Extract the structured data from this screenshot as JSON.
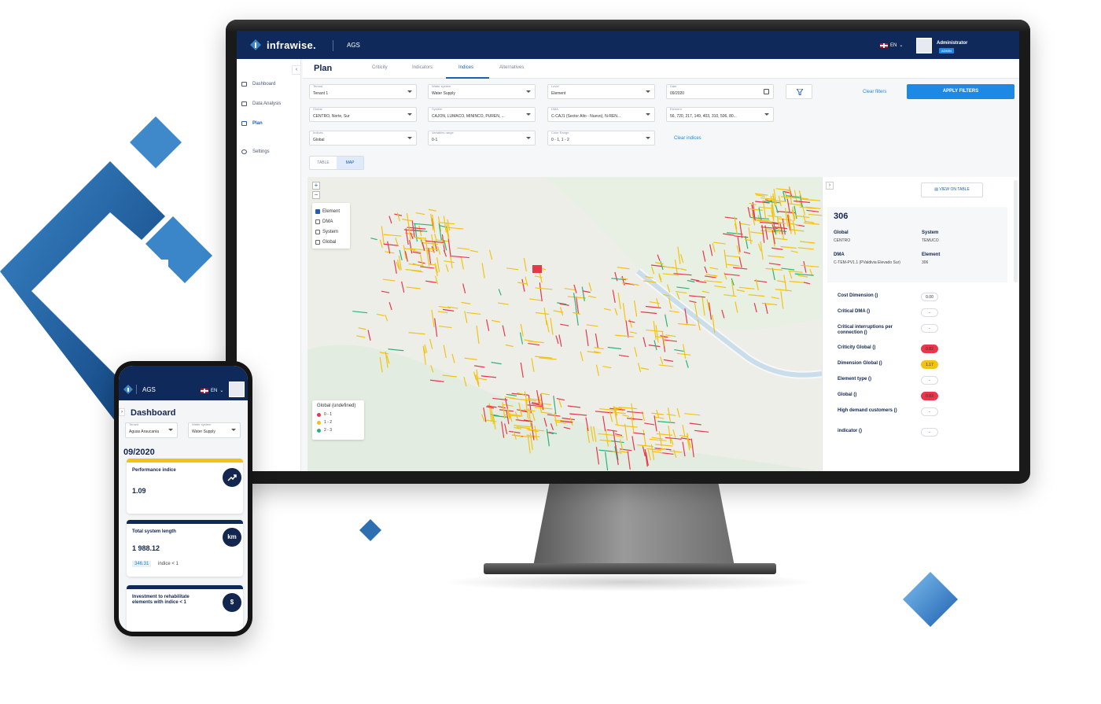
{
  "colors": {
    "navy": "#0f2a5a",
    "accent": "#1e88e5",
    "yellow": "#f2c314",
    "red": "#e8374a",
    "green": "#2bb27a"
  },
  "desktop": {
    "header": {
      "logo_text": "infrawise.",
      "app_name": "AGS",
      "language": "EN",
      "user_name": "Administrator",
      "user_role": "ADMIN"
    },
    "sidebar": {
      "items": [
        {
          "label": "Dashboard",
          "icon": "dashboard-icon"
        },
        {
          "label": "Data Analysis",
          "icon": "chart-icon"
        },
        {
          "label": "Plan",
          "icon": "plan-icon",
          "active": true
        },
        {
          "label": "Settings",
          "icon": "gear-icon"
        }
      ],
      "collapse_glyph": "‹"
    },
    "page": {
      "title": "Plan",
      "tabs": [
        "Criticity",
        "Indicators",
        "Indices",
        "Alternatives"
      ],
      "active_tab": "Indices"
    },
    "filters": {
      "tenant": {
        "label": "Tenant",
        "value": "Tenant 1"
      },
      "water_system": {
        "label": "Water system",
        "value": "Water Supply"
      },
      "level": {
        "label": "Level",
        "value": "Element"
      },
      "date": {
        "label": "Date",
        "value": "09/2020"
      },
      "global": {
        "label": "Global",
        "value": "CENTRO, Norte, Sur"
      },
      "system": {
        "label": "System",
        "value": "CAJON, LUMACO, MININCO, PUREN, ..."
      },
      "dma": {
        "label": "DMA",
        "value": "C-CAJ1 (Sector Alto - Nuevo), N-REN..."
      },
      "element": {
        "label": "Element",
        "value": "56, 720, 217, 149, 403, 310, 506, 80..."
      },
      "indices": {
        "label": "Indices",
        "value": "Global"
      },
      "variables_range": {
        "label": "Variables range",
        "value": "0-1"
      },
      "color_range": {
        "label": "Color Range",
        "value": "0 - 1, 1 - 2"
      },
      "clear_filters": "Clear filters",
      "apply_filters": "APPLY FILTERS",
      "clear_indices": "Clear indices"
    },
    "view_toggle": {
      "table": "TABLE",
      "map": "MAP",
      "active": "MAP"
    },
    "map": {
      "zoom_in": "+",
      "zoom_out": "−",
      "layers": [
        {
          "label": "Element",
          "checked": true
        },
        {
          "label": "DMA",
          "checked": false
        },
        {
          "label": "System",
          "checked": false
        },
        {
          "label": "Global",
          "checked": false
        }
      ],
      "legend": {
        "title": "Global (undefined)",
        "items": [
          {
            "label": "0 - 1",
            "color": "#e8374a"
          },
          {
            "label": "1 - 2",
            "color": "#f2c314"
          },
          {
            "label": "2 - 3",
            "color": "#2bb27a"
          }
        ]
      }
    },
    "details": {
      "view_on_table": "VIEW ON TABLE",
      "id": "306",
      "fields": {
        "global_label": "Global",
        "global_value": "CENTRO",
        "system_label": "System",
        "system_value": "TEMUCO",
        "dma_label": "DMA",
        "dma_value": "C-TEM-PV1.1 (PValdivia Elevado Sur)",
        "element_label": "Element",
        "element_value": "306"
      },
      "metrics": [
        {
          "name": "Cost Dimension ()",
          "value": "0.00",
          "color": "#ffffff"
        },
        {
          "name": "Critical DMA ()",
          "value": "-",
          "color": "#ffffff"
        },
        {
          "name": "Critical interruptions per connection ()",
          "value": "-",
          "color": "#ffffff"
        },
        {
          "name": "Criticity Global ()",
          "value": "0.82",
          "color": "#e8374a"
        },
        {
          "name": "Dimension Global ()",
          "value": "1.17",
          "color": "#f2c314"
        },
        {
          "name": "Element type ()",
          "value": "-",
          "color": "#ffffff"
        },
        {
          "name": "Global ()",
          "value": "0.83",
          "color": "#e8374a"
        },
        {
          "name": "High demand customers ()",
          "value": "-",
          "color": "#ffffff"
        },
        {
          "name": "indicator ()",
          "value": "-",
          "color": "#ffffff"
        }
      ]
    }
  },
  "mobile": {
    "app_name": "AGS",
    "language": "EN",
    "title": "Dashboard",
    "tenant": {
      "label": "Tenant",
      "value": "Aguas Araucanía"
    },
    "water_system": {
      "label": "Water system",
      "value": "Water Supply"
    },
    "date": "09/2020",
    "cards": [
      {
        "label": "Performance indice",
        "value": "1.09",
        "icon": "trend-up-icon",
        "bar": "#f2c314"
      },
      {
        "label": "Total system length",
        "value": "1 988.12",
        "icon_text": "km",
        "tag": "346.31",
        "tag_note": "indice < 1",
        "bar": "#0f2a5a"
      },
      {
        "label": "Investment to rehabilitate elements with indice < 1",
        "icon_text": "$",
        "bar": "#0f2a5a"
      }
    ]
  }
}
